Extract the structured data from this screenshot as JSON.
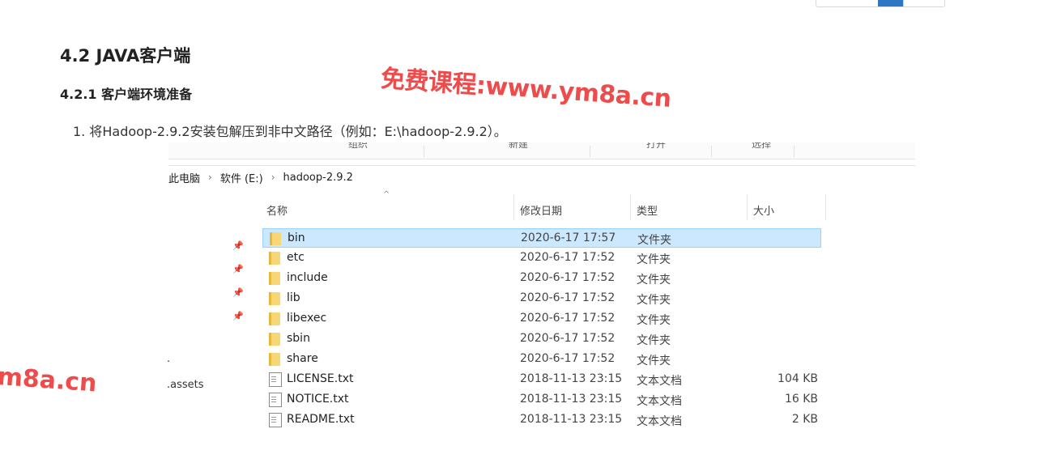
{
  "article": {
    "section_title": "4.2 JAVA客户端",
    "subsection_title": "4.2.1 客户端环境准备",
    "step1": "1. 将Hadoop-2.9.2安装包解压到非中文路径（例如：E:\\hadoop-2.9.2）。"
  },
  "watermarks": {
    "main": "免费课程:www.ym8a.cn",
    "left": "m8a.cn"
  },
  "explorer": {
    "toolbar_groups": [
      "组织",
      "新建",
      "打开",
      "选择"
    ],
    "breadcrumb": [
      "此电脑",
      "软件 (E:)",
      "hadoop-2.9.2"
    ],
    "columns": {
      "name": "名称",
      "date": "修改日期",
      "type": "类型",
      "size": "大小"
    },
    "sidebar_tail": {
      "dot": "·",
      "label": ".assets"
    },
    "files": [
      {
        "name": "bin",
        "date": "2020-6-17 17:57",
        "type": "文件夹",
        "size": "",
        "kind": "folder",
        "selected": true
      },
      {
        "name": "etc",
        "date": "2020-6-17 17:52",
        "type": "文件夹",
        "size": "",
        "kind": "folder"
      },
      {
        "name": "include",
        "date": "2020-6-17 17:52",
        "type": "文件夹",
        "size": "",
        "kind": "folder"
      },
      {
        "name": "lib",
        "date": "2020-6-17 17:52",
        "type": "文件夹",
        "size": "",
        "kind": "folder"
      },
      {
        "name": "libexec",
        "date": "2020-6-17 17:52",
        "type": "文件夹",
        "size": "",
        "kind": "folder"
      },
      {
        "name": "sbin",
        "date": "2020-6-17 17:52",
        "type": "文件夹",
        "size": "",
        "kind": "folder"
      },
      {
        "name": "share",
        "date": "2020-6-17 17:52",
        "type": "文件夹",
        "size": "",
        "kind": "folder"
      },
      {
        "name": "LICENSE.txt",
        "date": "2018-11-13 23:15",
        "type": "文本文档",
        "size": "104 KB",
        "kind": "file"
      },
      {
        "name": "NOTICE.txt",
        "date": "2018-11-13 23:15",
        "type": "文本文档",
        "size": "16 KB",
        "kind": "file"
      },
      {
        "name": "README.txt",
        "date": "2018-11-13 23:15",
        "type": "文本文档",
        "size": "2 KB",
        "kind": "file"
      }
    ]
  },
  "colors": {
    "accent": "#2f77c4",
    "watermark": "#ee4c4c",
    "selection": "#cce8ff"
  }
}
